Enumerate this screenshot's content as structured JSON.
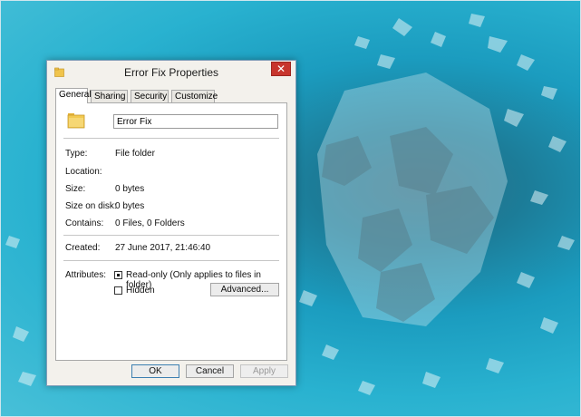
{
  "window": {
    "title": "Error Fix Properties",
    "close_glyph": "✕",
    "tabs": [
      {
        "label": "General",
        "active": true
      },
      {
        "label": "Sharing",
        "active": false
      },
      {
        "label": "Security",
        "active": false
      },
      {
        "label": "Customize",
        "active": false
      }
    ]
  },
  "general": {
    "name_value": "Error Fix",
    "type_label": "Type:",
    "type_value": "File folder",
    "location_label": "Location:",
    "location_value": "",
    "size_label": "Size:",
    "size_value": "0 bytes",
    "size_on_disk_label": "Size on disk:",
    "size_on_disk_value": "0 bytes",
    "contains_label": "Contains:",
    "contains_value": "0 Files, 0 Folders",
    "created_label": "Created:",
    "created_value": "27 June 2017, 21:46:40",
    "attributes_label": "Attributes:",
    "readonly_label": "Read-only (Only applies to files in folder)",
    "readonly_state": "indeterminate",
    "hidden_label": "Hidden",
    "hidden_checked": false,
    "advanced_label": "Advanced..."
  },
  "footer": {
    "ok_label": "OK",
    "cancel_label": "Cancel",
    "apply_label": "Apply"
  },
  "colors": {
    "close_button": "#c7352d",
    "folder": "#f0c44c",
    "desktop": "#1b9cbf"
  },
  "icons": [
    "folder-icon",
    "close-icon"
  ]
}
